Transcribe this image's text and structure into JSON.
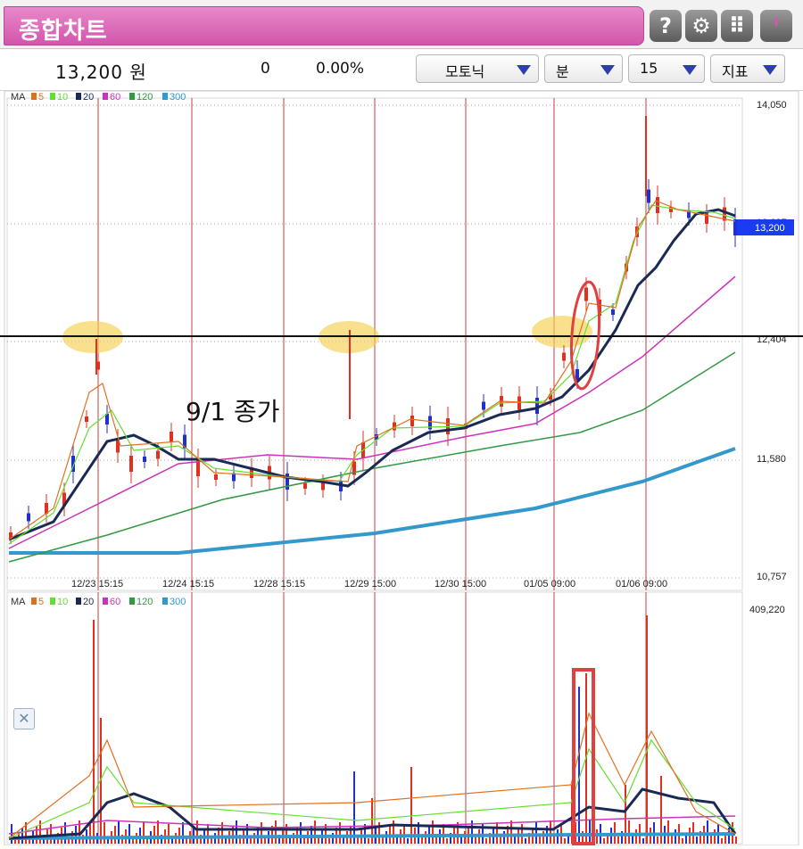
{
  "titlebar": {
    "title": "종합차트",
    "buttons": [
      {
        "name": "help-button",
        "icon": "help-icon",
        "glyph": "?"
      },
      {
        "name": "settings-button",
        "icon": "gear-icon",
        "glyph": "⚙"
      },
      {
        "name": "grid-button",
        "icon": "keypad-icon",
        "glyph": "⠿"
      },
      {
        "name": "info-button",
        "icon": "info-icon",
        "glyph": "ⁱ"
      }
    ]
  },
  "toolbar": {
    "price": "13,200 원",
    "change": "0",
    "change_pct": "0.00%",
    "dropdowns": [
      {
        "name": "stock-select",
        "value": "모토닉"
      },
      {
        "name": "period-select",
        "value": "분"
      },
      {
        "name": "interval-select",
        "value": "15"
      },
      {
        "name": "indicator-select",
        "value": "지표"
      }
    ]
  },
  "price_chart": {
    "legend": {
      "label": "MA",
      "items": [
        {
          "period": "5",
          "color": "#e07020"
        },
        {
          "period": "10",
          "color": "#66dd33"
        },
        {
          "period": "20",
          "color": "#1a2a55"
        },
        {
          "period": "60",
          "color": "#cc33bb"
        },
        {
          "period": "120",
          "color": "#339944"
        },
        {
          "period": "300",
          "color": "#3399cc"
        }
      ]
    },
    "y_ticks": [
      "14,050",
      "13,227",
      "12,404",
      "11,580",
      "10,757"
    ],
    "current_price_tag": "13,200",
    "x_ticks": [
      "12/23 15:15",
      "12/24 15:15",
      "12/28 15:15",
      "12/29 15:00",
      "12/30 15:00",
      "01/05 09:00",
      "01/06 09:00"
    ],
    "annotation": "9/1 종가"
  },
  "volume_chart": {
    "legend": {
      "label": "MA",
      "items": [
        {
          "period": "5",
          "color": "#e07020"
        },
        {
          "period": "10",
          "color": "#66dd33"
        },
        {
          "period": "20",
          "color": "#1a2a55"
        },
        {
          "period": "60",
          "color": "#cc33bb"
        },
        {
          "period": "120",
          "color": "#339944"
        },
        {
          "period": "300",
          "color": "#3399cc"
        }
      ]
    },
    "y_max_label": "409,220",
    "close_glyph": "✕"
  },
  "colors": {
    "title_pink": "#d255ad",
    "up_red": "#e03020",
    "down_blue": "#2030cc",
    "marker_red": "#e04040",
    "highlight_yellow": "#f5d050",
    "price_tag_blue": "#1a3cf0"
  }
}
